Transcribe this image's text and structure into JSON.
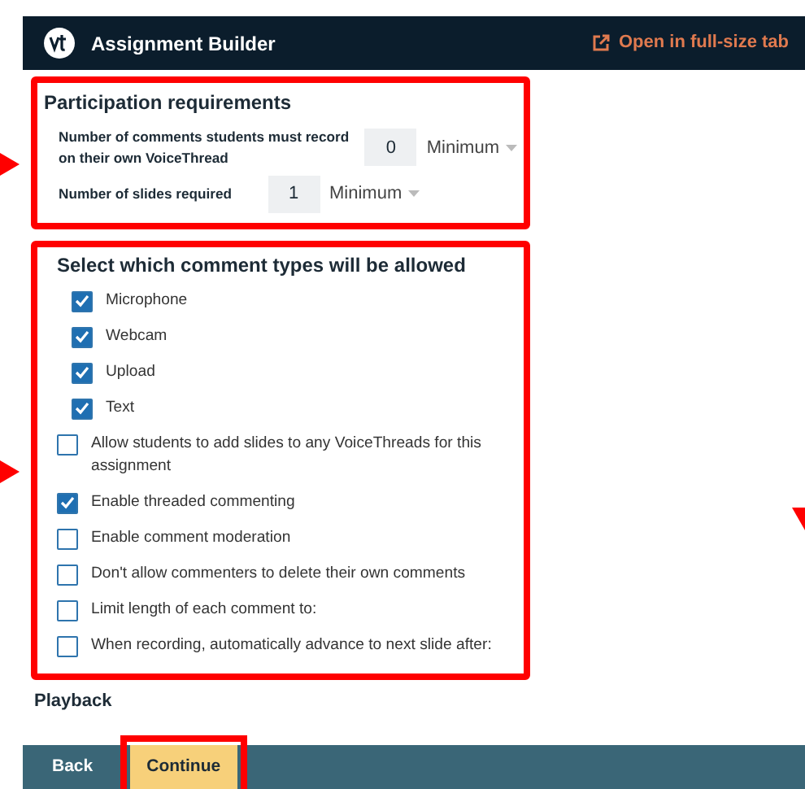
{
  "app": {
    "title": "Assignment Builder",
    "open_link": "Open in full-size tab"
  },
  "participation": {
    "heading": "Participation requirements",
    "fields": [
      {
        "label": "Number of comments students must record on their own VoiceThread",
        "value": "0",
        "unit": "Minimum"
      },
      {
        "label": "Number of slides required",
        "value": "1",
        "unit": "Minimum"
      }
    ]
  },
  "comment_types": {
    "heading": "Select which comment types will be allowed",
    "options": [
      {
        "kind": "type",
        "label": "Microphone",
        "checked": true
      },
      {
        "kind": "type",
        "label": "Webcam",
        "checked": true
      },
      {
        "kind": "type",
        "label": "Upload",
        "checked": true
      },
      {
        "kind": "type",
        "label": "Text",
        "checked": true
      },
      {
        "kind": "option",
        "label": "Allow students to add slides to any VoiceThreads for this assignment",
        "checked": false
      },
      {
        "kind": "option",
        "label": "Enable threaded commenting",
        "checked": true
      },
      {
        "kind": "option",
        "label": "Enable comment moderation",
        "checked": false
      },
      {
        "kind": "option",
        "label": "Don't allow commenters to delete their own comments",
        "checked": false
      },
      {
        "kind": "option",
        "label": "Limit length of each comment to:",
        "checked": false
      },
      {
        "kind": "option",
        "label": "When recording, automatically advance to next slide after:",
        "checked": false
      }
    ]
  },
  "next_heading": "Playback",
  "footer": {
    "buttons": [
      {
        "label": "Back",
        "primary": false
      },
      {
        "label": "Continue",
        "primary": true
      }
    ]
  }
}
